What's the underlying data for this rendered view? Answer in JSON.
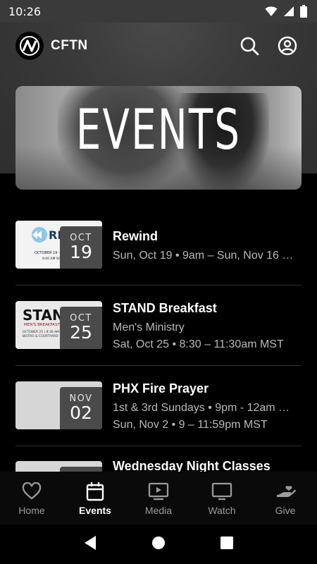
{
  "status_bar": {
    "time": "10:26"
  },
  "app_bar": {
    "title": "CFTN",
    "logo_icon": "cftn-logo-icon",
    "search_icon": "search-icon",
    "account_icon": "account-icon"
  },
  "banner": {
    "title": "EVENTS"
  },
  "events": [
    {
      "month": "OCT",
      "day": "19",
      "title": "Rewind",
      "lines": [
        "Sun, Oct 19 • 9am – Sun, Nov 16 …"
      ],
      "thumb_text": [
        "REWIND",
        "OCTOBER 19 - NOVEMBER 16",
        "9:00 AM SOM ROOM"
      ]
    },
    {
      "month": "OCT",
      "day": "25",
      "title": "STAND Breakfast",
      "lines": [
        "Men's Ministry",
        "Sat, Oct 25 • 8:30 – 11:30am MST"
      ],
      "thumb_text": [
        "STAND",
        "MEN'S BREAKFAST",
        "OCTOBER 25 | 8:30 AM",
        "BISTRO & COURTYARD"
      ]
    },
    {
      "month": "NOV",
      "day": "02",
      "title": "PHX Fire Prayer",
      "lines": [
        "1st & 3rd Sundays • 9pm - 12am …",
        "Sun, Nov 2 • 9 – 11:59pm MST"
      ]
    },
    {
      "title": "Wednesday Night Classes"
    }
  ],
  "bottom_nav": [
    {
      "label": "Home",
      "icon": "heart-icon",
      "active": false
    },
    {
      "label": "Events",
      "icon": "calendar-icon",
      "active": true
    },
    {
      "label": "Media",
      "icon": "media-icon",
      "active": false
    },
    {
      "label": "Watch",
      "icon": "tv-icon",
      "active": false
    },
    {
      "label": "Give",
      "icon": "give-icon",
      "active": false
    }
  ],
  "colors": {
    "background": "#000000",
    "header": "#3a3a3a",
    "text_secondary": "#b9b9b9",
    "nav_inactive": "#9a9a9a"
  }
}
